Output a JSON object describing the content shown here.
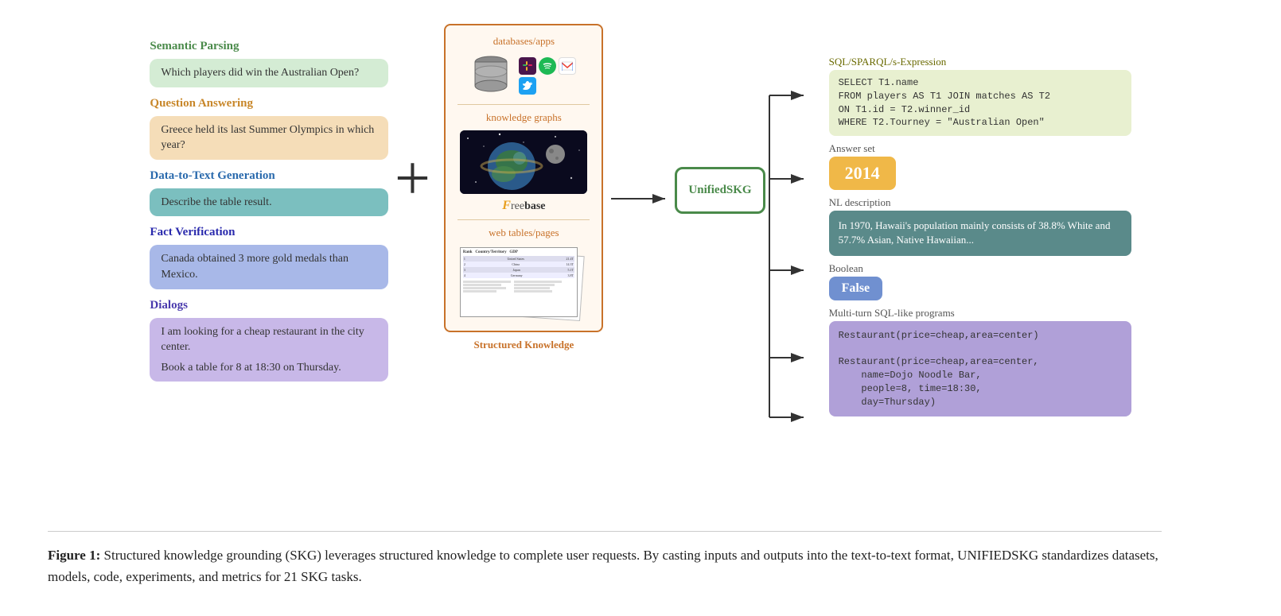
{
  "diagram": {
    "left": {
      "tasks": [
        {
          "id": "semantic-parsing",
          "title": "Semantic Parsing",
          "title_color": "semantic-title",
          "bubble_class": "semantic-bubble",
          "text": "Which players did win the Australian Open?"
        },
        {
          "id": "question-answering",
          "title": "Question Answering",
          "title_color": "qa-title",
          "bubble_class": "qa-bubble",
          "text": "Greece held its last Summer Olympics in which year?"
        },
        {
          "id": "data-to-text",
          "title": "Data-to-Text Generation",
          "title_color": "d2t-title",
          "bubble_class": "d2t-bubble",
          "text": "Describe the table result."
        },
        {
          "id": "fact-verification",
          "title": "Fact Verification",
          "title_color": "fv-title",
          "bubble_class": "fv-bubble",
          "text": "Canada obtained 3 more gold medals than Mexico."
        },
        {
          "id": "dialogs",
          "title": "Dialogs",
          "title_color": "dialogs-title",
          "bubble_class": "dialogs-bubble",
          "text1": "I am looking for a cheap restaurant in the city center.",
          "text2": "Book a table for 8 at 18:30 on Thursday."
        }
      ]
    },
    "middle": {
      "sk_title1": "databases/apps",
      "sk_title2": "knowledge graphs",
      "freebase_label": "Freebase",
      "sk_title3": "web tables/pages",
      "structured_knowledge_label": "Structured Knowledge"
    },
    "unified_label": "UnifiedSKG",
    "right": {
      "outputs": [
        {
          "id": "sql",
          "label": "SQL/SPARQL/s-Expression",
          "label_color": "sql-label-text",
          "bubble_class": "sql-bubble",
          "text": "SELECT T1.name\nFROM players AS T1 JOIN matches AS T2\nON T1.id = T2.winner_id\nWHERE T2.Tourney = \"Australian Open\""
        },
        {
          "id": "answer",
          "label": "Answer set",
          "label_color": "answer-label-text",
          "text": "2014"
        },
        {
          "id": "nl",
          "label": "NL description",
          "label_color": "nl-label-text",
          "bubble_class": "nl-bubble",
          "text": "In 1970, Hawaii's population mainly consists of 38.8% White and 57.7% Asian, Native Hawaiian..."
        },
        {
          "id": "boolean",
          "label": "Boolean",
          "label_color": "bool-label-text",
          "text": "False"
        },
        {
          "id": "multiturn",
          "label": "Multi-turn SQL-like programs",
          "label_color": "mt-label-text",
          "bubble_class": "mt-bubble",
          "text": "Restaurant(price=cheap,area=center)\n\nRestaurant(price=cheap,area=center,\n    name=Dojo Noodle Bar,\n    people=8, time=18:30,\n    day=Thursday)"
        }
      ]
    }
  },
  "caption": {
    "fig_label": "Figure 1:",
    "text": " Structured knowledge grounding (SKG) leverages structured knowledge to complete user requests.  By casting inputs and outputs into the text-to-text format, ",
    "unified_name": "UnifiedSKG",
    "text2": " standardizes datasets, models, code, experiments, and metrics for 21 SKG tasks."
  }
}
